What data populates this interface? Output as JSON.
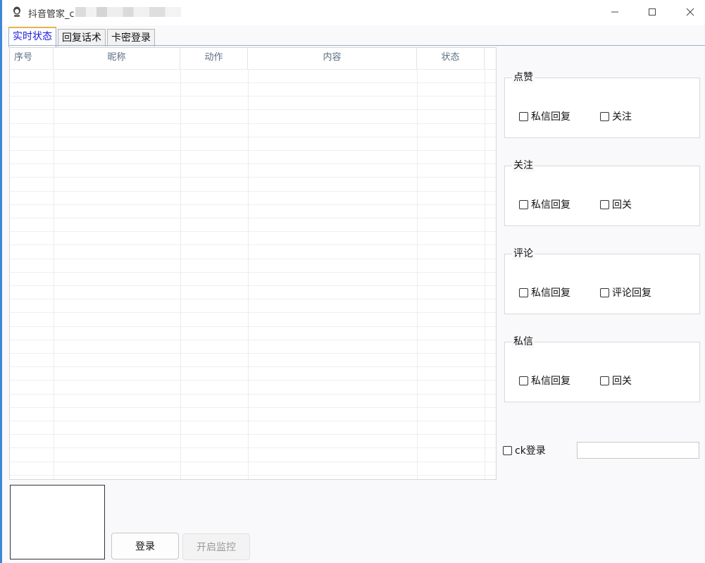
{
  "window": {
    "title": "抖音管家_c"
  },
  "tabs": [
    {
      "label": "实时状态",
      "active": true
    },
    {
      "label": "回复话术",
      "active": false
    },
    {
      "label": "卡密登录",
      "active": false
    }
  ],
  "table": {
    "columns": [
      "序号",
      "昵称",
      "动作",
      "内容",
      "状态"
    ],
    "rows": []
  },
  "groups": {
    "like": {
      "title": "点赞",
      "options": [
        "私信回复",
        "关注"
      ]
    },
    "follow": {
      "title": "关注",
      "options": [
        "私信回复",
        "回关"
      ]
    },
    "comment": {
      "title": "评论",
      "options": [
        "私信回复",
        "评论回复"
      ]
    },
    "dm": {
      "title": "私信",
      "options": [
        "私信回复",
        "回关"
      ]
    }
  },
  "ck": {
    "label": "ck登录",
    "value": ""
  },
  "buttons": {
    "login": "登录",
    "start_monitor": "开启监控"
  },
  "colors": {
    "accent_border": "#3d86d8",
    "active_tab_text": "#1a1adc",
    "active_tab_top": "#e5b74a"
  },
  "icons": {
    "app": "app-logo-icon",
    "minimize": "minimize-icon",
    "maximize": "maximize-icon",
    "close": "close-icon"
  }
}
